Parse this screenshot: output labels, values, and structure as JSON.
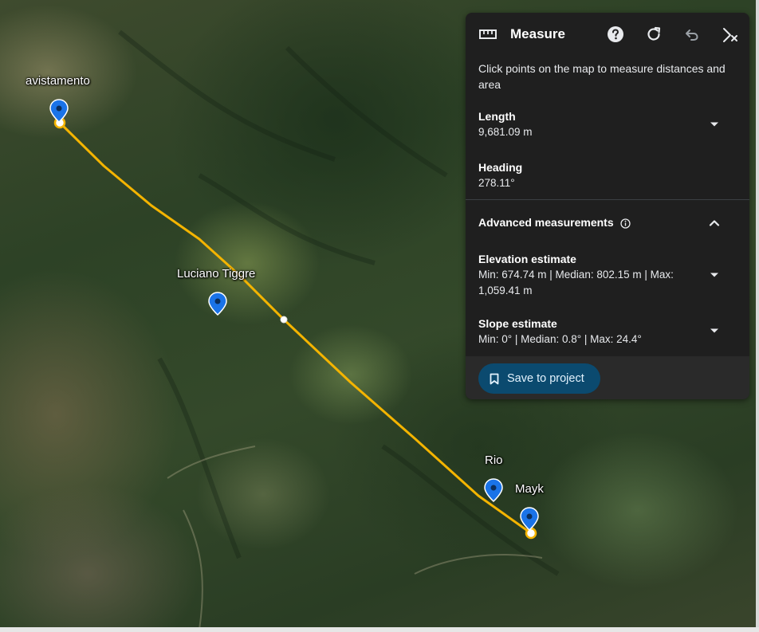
{
  "map": {
    "labels": {
      "avistamento": "avistamento",
      "luciano": "Luciano Tiggre",
      "rio": "Rio",
      "mayk": "Mayk"
    },
    "route_color": "#f4b400",
    "pin_color": "#1a73e8"
  },
  "panel": {
    "title": "Measure",
    "description": "Click points on the map to measure distances and area",
    "icons": {
      "ruler": "ruler-icon",
      "help": "help-icon",
      "refresh": "refresh-icon",
      "undo": "undo-icon",
      "close": "close-measure-icon"
    },
    "length": {
      "label": "Length",
      "value": "9,681.09 m"
    },
    "heading": {
      "label": "Heading",
      "value": "278.11°"
    },
    "advanced": {
      "label": "Advanced measurements"
    },
    "elevation": {
      "label": "Elevation estimate",
      "value": "Min: 674.74 m | Median: 802.15 m | Max: 1,059.41 m"
    },
    "slope": {
      "label": "Slope estimate",
      "value": "Min: 0° | Median: 0.8° | Max: 24.4°"
    },
    "save_label": "Save to project",
    "accent": "#0b4a6f"
  }
}
